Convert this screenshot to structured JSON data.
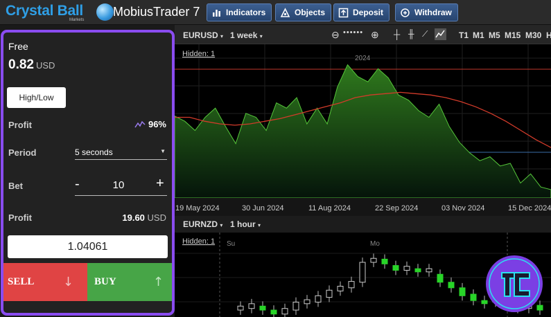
{
  "header": {
    "brand": "Crystal Ball",
    "brand_sub": "Markets",
    "app_title": "MobiusTrader 7",
    "buttons": [
      {
        "label": "Indicators",
        "icon": "bar-chart-icon"
      },
      {
        "label": "Objects",
        "icon": "objects-icon"
      },
      {
        "label": "Deposit",
        "icon": "deposit-icon"
      },
      {
        "label": "Withdraw",
        "icon": "withdraw-icon"
      }
    ]
  },
  "trade_panel": {
    "account_label": "Free",
    "balance": "0.82",
    "balance_currency": "USD",
    "option_type": "High/Low",
    "profit_label": "Profit",
    "profit_pct": "96%",
    "period_label": "Period",
    "period_value": "5 seconds",
    "bet_label": "Bet",
    "bet_minus": "-",
    "bet_value": "10",
    "bet_plus": "+",
    "payout_label": "Profit",
    "payout_value": "19.60",
    "payout_currency": "USD",
    "price": "1.04061",
    "sell_label": "SELL",
    "buy_label": "BUY",
    "accent_color": "#8a4cf0",
    "sell_color": "#e04444",
    "buy_color": "#47a547"
  },
  "chart_toolbar": {
    "symbol": "EURUSD",
    "period": "1 week",
    "timeframes": [
      "T1",
      "M1",
      "M5",
      "M15",
      "M30",
      "H"
    ]
  },
  "chart_top": {
    "hidden_label": "Hidden: 1",
    "year_label": "2024",
    "x_labels": [
      "19 May 2024",
      "30 Jun 2024",
      "11 Aug 2024",
      "22 Sep 2024",
      "03 Nov 2024",
      "15 Dec 2024"
    ]
  },
  "chart_bottom": {
    "symbol": "EURNZD",
    "period": "1 hour",
    "hidden_label": "Hidden: 1",
    "day_labels": [
      "Su",
      "Mo"
    ]
  },
  "chart_data": [
    {
      "type": "area",
      "symbol": "EURUSD",
      "x": [
        "19 May 2024",
        "30 Jun 2024",
        "11 Aug 2024",
        "22 Sep 2024",
        "03 Nov 2024",
        "15 Dec 2024"
      ],
      "series": [
        {
          "values": [
            0.56,
            0.52,
            0.45,
            0.55,
            0.62,
            0.48,
            0.35,
            0.58,
            0.55,
            0.45,
            0.66,
            0.62,
            0.7,
            0.5,
            0.62,
            0.5,
            0.78,
            0.95,
            0.86,
            0.82,
            0.92,
            0.85,
            0.72,
            0.68,
            0.6,
            0.55,
            0.65,
            0.48,
            0.36,
            0.28,
            0.22,
            0.25,
            0.18,
            0.2,
            0.05,
            0.12,
            0.02,
            0.0
          ]
        },
        {
          "values": [
            0.55,
            0.55,
            0.52,
            0.5,
            0.49,
            0.5,
            0.52,
            0.54,
            0.57,
            0.6,
            0.63,
            0.66,
            0.7,
            0.72,
            0.73,
            0.74,
            0.73,
            0.72,
            0.7,
            0.67,
            0.63,
            0.58,
            0.52,
            0.45,
            0.38,
            0.32
          ]
        }
      ]
    },
    {
      "type": "candlestick",
      "symbol": "EURNZD",
      "x_labels": [
        "Su",
        "Mo"
      ],
      "candles": [
        {
          "o": 0.2,
          "c": 0.25,
          "dir": "up"
        },
        {
          "o": 0.22,
          "c": 0.28,
          "dir": "up"
        },
        {
          "o": 0.25,
          "c": 0.2,
          "dir": "down"
        },
        {
          "o": 0.2,
          "c": 0.15,
          "dir": "down"
        },
        {
          "o": 0.15,
          "c": 0.22,
          "dir": "up"
        },
        {
          "o": 0.2,
          "c": 0.3,
          "dir": "up"
        },
        {
          "o": 0.28,
          "c": 0.33,
          "dir": "up"
        },
        {
          "o": 0.3,
          "c": 0.38,
          "dir": "up"
        },
        {
          "o": 0.36,
          "c": 0.45,
          "dir": "up"
        },
        {
          "o": 0.44,
          "c": 0.5,
          "dir": "up"
        },
        {
          "o": 0.48,
          "c": 0.56,
          "dir": "up"
        },
        {
          "o": 0.55,
          "c": 0.8,
          "dir": "up"
        },
        {
          "o": 0.8,
          "c": 0.85,
          "dir": "up"
        },
        {
          "o": 0.84,
          "c": 0.78,
          "dir": "down"
        },
        {
          "o": 0.76,
          "c": 0.7,
          "dir": "down"
        },
        {
          "o": 0.7,
          "c": 0.75,
          "dir": "up"
        },
        {
          "o": 0.72,
          "c": 0.68,
          "dir": "down"
        },
        {
          "o": 0.68,
          "c": 0.72,
          "dir": "up"
        },
        {
          "o": 0.65,
          "c": 0.55,
          "dir": "down"
        },
        {
          "o": 0.55,
          "c": 0.48,
          "dir": "down"
        },
        {
          "o": 0.48,
          "c": 0.38,
          "dir": "down"
        },
        {
          "o": 0.4,
          "c": 0.32,
          "dir": "down"
        },
        {
          "o": 0.32,
          "c": 0.28,
          "dir": "down"
        },
        {
          "o": 0.3,
          "c": 0.36,
          "dir": "up"
        },
        {
          "o": 0.35,
          "c": 0.3,
          "dir": "down"
        },
        {
          "o": 0.3,
          "c": 0.22,
          "dir": "down"
        },
        {
          "o": 0.22,
          "c": 0.28,
          "dir": "up"
        },
        {
          "o": 0.26,
          "c": 0.2,
          "dir": "down"
        }
      ]
    }
  ]
}
